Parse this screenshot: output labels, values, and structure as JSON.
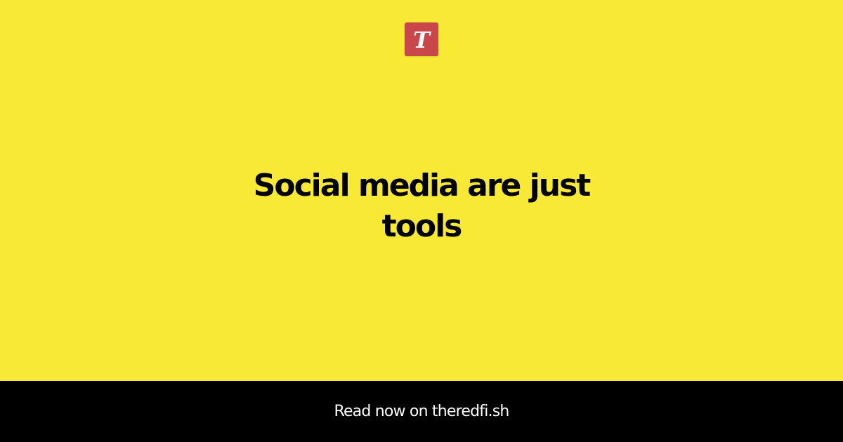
{
  "brand": {
    "logo_letter": "T",
    "logo_icon": "brand-logo-icon",
    "logo_color": "#c9464a"
  },
  "article": {
    "title": "Social media are just tools"
  },
  "footer": {
    "cta_text": "Read now on theredfi.sh"
  },
  "colors": {
    "background": "#f9e937",
    "footer_background": "#000000",
    "title": "#000000",
    "footer_text": "#ffffff"
  }
}
